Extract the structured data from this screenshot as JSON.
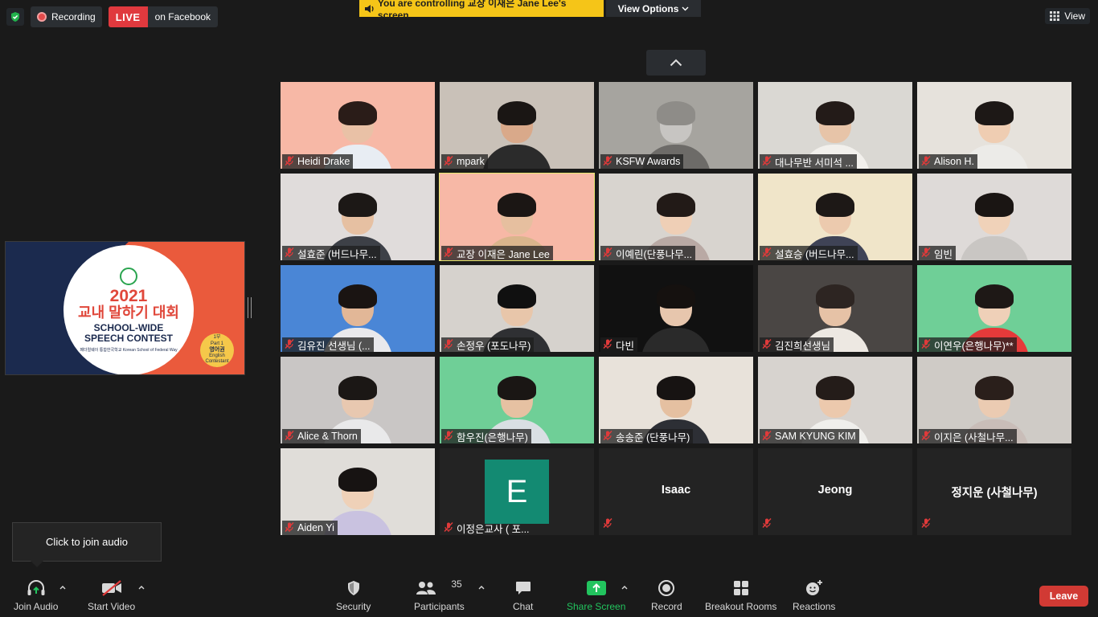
{
  "top": {
    "recording_label": "Recording",
    "live_label": "LIVE",
    "live_target": "on Facebook",
    "control_banner": "You  are  controlling 교장 이재은  Jane Lee's screen",
    "view_options": "View Options",
    "view_button": "View"
  },
  "share": {
    "year": "2021",
    "title_kr": "교내 말하기 대회",
    "title_en_1": "SCHOOL-WIDE",
    "title_en_2": "SPEECH CONTEST",
    "school": "페더럴웨이 통합한국학교 Korean School of Federal Way",
    "badge_1": "1부",
    "badge_2": "Part 1",
    "badge_3": "영어권",
    "badge_4": "English Contestant"
  },
  "participants": [
    {
      "name": "Heidi Drake",
      "bg": "#f7b8a6",
      "shirt": "#e8edf3",
      "skin": "#e9c1a6",
      "hair": "#2a1c18",
      "banner": true
    },
    {
      "name": "mpark",
      "bg": "#c9c1b8",
      "shirt": "#2b2b2b",
      "skin": "#d9a98a",
      "hair": "#1a1614",
      "banner": false
    },
    {
      "name": "KSFW Awards",
      "bg": "#a6a49f",
      "shirt": "#6d6b68",
      "skin": "#c7c5c2",
      "hair": "#8e8c88",
      "banner": false
    },
    {
      "name": "대나무반 서미석 ...",
      "bg": "#dad8d3",
      "shirt": "#f2f0ec",
      "skin": "#e7c4a8",
      "hair": "#231b18",
      "banner": false
    },
    {
      "name": "Alison H.",
      "bg": "#e6e2dc",
      "shirt": "#ecebe8",
      "skin": "#efcdb2",
      "hair": "#1d1816",
      "banner": false
    },
    {
      "name": "설효준 (버드나무...",
      "bg": "#e0dcdb",
      "shirt": "#3d4047",
      "skin": "#e6c0a2",
      "hair": "#1c1816",
      "banner": false
    },
    {
      "name": "교장 이재은 Jane Lee",
      "bg": "#f7b8a6",
      "shirt": "#d9b58c",
      "skin": "#e6bf9f",
      "hair": "#1b1614",
      "banner": true,
      "active": true
    },
    {
      "name": "이예린(단풍나무...",
      "bg": "#d8d4cf",
      "shirt": "#b9a9a4",
      "skin": "#efcfb6",
      "hair": "#221a17",
      "banner": false
    },
    {
      "name": "설효승 (버드나무...",
      "bg": "#f0e5c9",
      "shirt": "#3f4356",
      "skin": "#eccaae",
      "hair": "#1d1816",
      "banner": false
    },
    {
      "name": "임빈",
      "bg": "#dedad8",
      "shirt": "#c9c6c3",
      "skin": "#f0d2b9",
      "hair": "#1a1513",
      "banner": false
    },
    {
      "name": "김유진 선생님 (...",
      "bg": "#4a86d6",
      "shirt": "#e9e9ec",
      "skin": "#e2b797",
      "hair": "#1a1412",
      "banner": true
    },
    {
      "name": "손정우 (포도나무)",
      "bg": "#d6d2cd",
      "shirt": "#2f3033",
      "skin": "#e8c6aa",
      "hair": "#101010",
      "banner": false
    },
    {
      "name": "다빈",
      "bg": "#111111",
      "shirt": "#2a2a2a",
      "skin": "#e7c6ad",
      "hair": "#15110f",
      "banner": false
    },
    {
      "name": "김진희선생님",
      "bg": "#4a4644",
      "shirt": "#ede8e2",
      "skin": "#e6c2a6",
      "hair": "#2d2522",
      "banner": false
    },
    {
      "name": "이연우(은행나무)**",
      "bg": "#6fcf97",
      "shirt": "#e53a3a",
      "skin": "#efd0b8",
      "hair": "#1e1816",
      "banner": true
    },
    {
      "name": "Alice & Thorn",
      "bg": "#c9c6c5",
      "shirt": "#e9e9ea",
      "skin": "#e8c8b0",
      "hair": "#1b1715",
      "banner": false
    },
    {
      "name": "함우진(은행나무)",
      "bg": "#6fcf97",
      "shirt": "#d9dfe3",
      "skin": "#e6c1a2",
      "hair": "#1a1614",
      "banner": true
    },
    {
      "name": "송송준 (단풍나무)",
      "bg": "#e8e2da",
      "shirt": "#2d2f35",
      "skin": "#e5c0a1",
      "hair": "#171312",
      "banner": false
    },
    {
      "name": "SAM KYUNG KIM",
      "bg": "#d7d3cf",
      "shirt": "#f0efec",
      "skin": "#ecc9ad",
      "hair": "#241c19",
      "banner": false
    },
    {
      "name": "이지은 (사철나무...",
      "bg": "#cfcbc6",
      "shirt": "#c9bdb8",
      "skin": "#ebcbb2",
      "hair": "#2a1f1b",
      "banner": false
    },
    {
      "name": "Aiden Yi",
      "bg": "#e0ddd9",
      "shirt": "#c9c2e0",
      "skin": "#efd1b8",
      "hair": "#171312",
      "banner": false
    }
  ],
  "avatar_tile": {
    "letter": "E",
    "name": "이정은교사 ( 포..."
  },
  "name_tiles": [
    "Isaac",
    "Jeong",
    "정지운 (사철나무)"
  ],
  "tooltip": "Click to join audio",
  "toolbar": {
    "join_audio": "Join Audio",
    "start_video": "Start Video",
    "security": "Security",
    "participants": "Participants",
    "participants_count": "35",
    "chat": "Chat",
    "share_screen": "Share Screen",
    "record": "Record",
    "breakout": "Breakout Rooms",
    "reactions": "Reactions",
    "leave": "Leave"
  }
}
